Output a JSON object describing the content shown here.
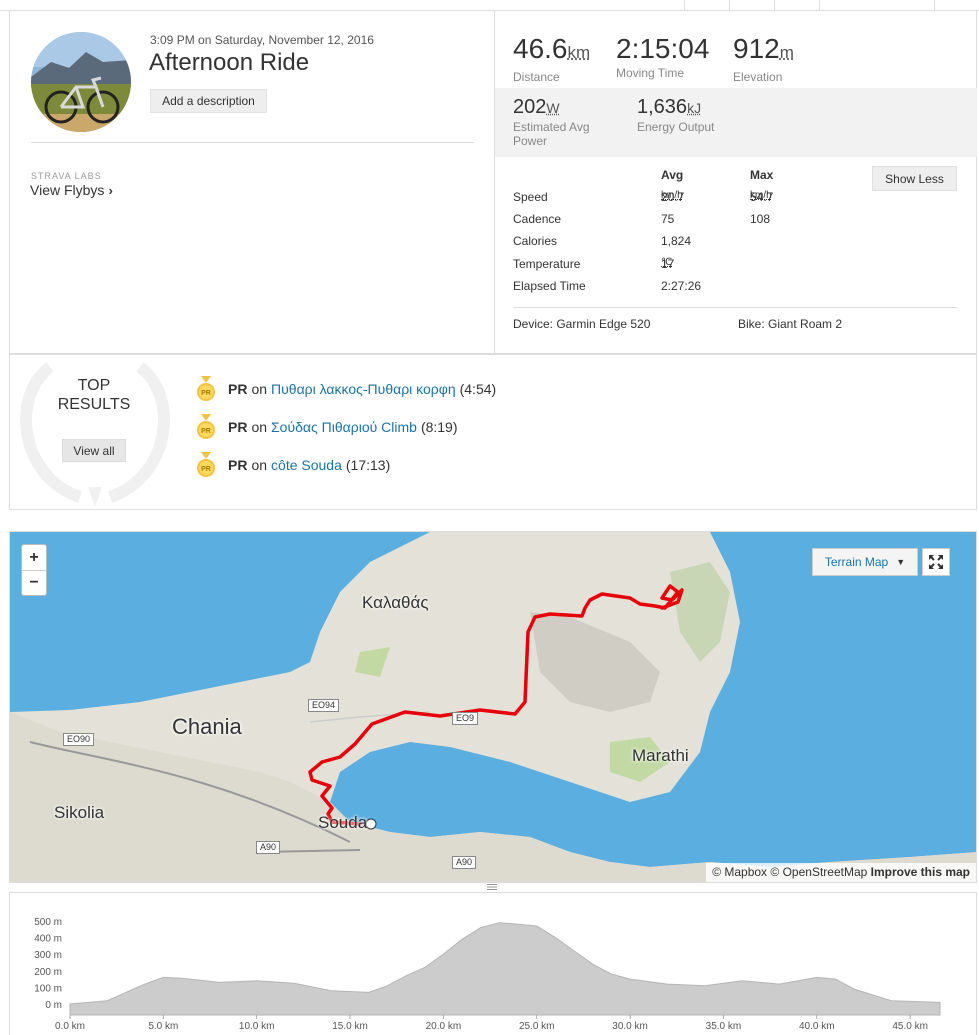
{
  "activity": {
    "timestamp": "3:09 PM on Saturday, November 12, 2016",
    "title": "Afternoon Ride",
    "add_description": "Add a description",
    "labs_label": "STRAVA LABS",
    "flybys_label": "View Flybys"
  },
  "stats": {
    "distance": {
      "value": "46.6",
      "unit": "km",
      "label": "Distance"
    },
    "moving_time": {
      "value": "2:15:04",
      "label": "Moving Time"
    },
    "elevation": {
      "value": "912",
      "unit": "m",
      "label": "Elevation"
    },
    "power": {
      "value": "202",
      "unit": "W",
      "label": "Estimated Avg Power"
    },
    "energy": {
      "value": "1,636",
      "unit": "kJ",
      "label": "Energy Output"
    }
  },
  "more_stats": {
    "avg_header": "Avg",
    "max_header": "Max",
    "show_less": "Show Less",
    "rows": [
      {
        "label": "Speed",
        "avg": "20.7",
        "avg_unit": "km/h",
        "max": "54.7",
        "max_unit": "km/h"
      },
      {
        "label": "Cadence",
        "avg": "75",
        "avg_unit": "",
        "max": "108",
        "max_unit": ""
      },
      {
        "label": "Calories",
        "avg": "1,824",
        "avg_unit": "",
        "max": "",
        "max_unit": ""
      },
      {
        "label": "Temperature",
        "avg": "17",
        "avg_unit": "℃",
        "max": "",
        "max_unit": ""
      },
      {
        "label": "Elapsed Time",
        "avg": "2:27:26",
        "avg_unit": "",
        "max": "",
        "max_unit": ""
      }
    ],
    "device": "Device: Garmin Edge 520",
    "bike": "Bike: Giant Roam 2"
  },
  "top_results": {
    "title_line1": "TOP",
    "title_line2": "RESULTS",
    "view_all": "View all",
    "items": [
      {
        "badge": "PR",
        "prefix": "PR",
        "on": "on",
        "segment": "Πυθαρι λακκος-Πυθαρι κορφη",
        "time": "(4:54)"
      },
      {
        "badge": "PR",
        "prefix": "PR",
        "on": "on",
        "segment": "Σούδας Πιθαριού Climb",
        "time": "(8:19)"
      },
      {
        "badge": "PR",
        "prefix": "PR",
        "on": "on",
        "segment": "côte Souda",
        "time": "(17:13)"
      }
    ]
  },
  "map": {
    "zoom_in": "+",
    "zoom_out": "−",
    "map_type": "Terrain Map",
    "labels": {
      "kalathas": "Καλαθάς",
      "chania": "Chania",
      "sikolia": "Sikolia",
      "souda": "Souda",
      "marathi": "Marathi"
    },
    "roads": {
      "eo94": "EO94",
      "eo90": "EO90",
      "a90a": "A90",
      "a90b": "A90",
      "eo": "EO9"
    },
    "attribution_mapbox": "© Mapbox",
    "attribution_osm": "© OpenStreetMap",
    "improve": "Improve this map",
    "route_color": "#e8000b"
  },
  "elevation_chart": {
    "y_ticks": [
      "500 m",
      "400 m",
      "300 m",
      "200 m",
      "100 m",
      "0 m"
    ],
    "x_ticks": [
      "0.0 km",
      "5.0 km",
      "10.0 km",
      "15.0 km",
      "20.0 km",
      "25.0 km",
      "30.0 km",
      "35.0 km",
      "40.0 km",
      "45.0 km"
    ]
  },
  "chart_data": {
    "type": "area",
    "xlabel": "",
    "ylabel": "",
    "xlim": [
      0,
      46.6
    ],
    "ylim": [
      -50,
      500
    ],
    "x": [
      0,
      2,
      4,
      5,
      6,
      8,
      10,
      12,
      14,
      16,
      17,
      18,
      19,
      20,
      21,
      22,
      23,
      24,
      25,
      26,
      27,
      28,
      29,
      30,
      32,
      34,
      36,
      38,
      40,
      41,
      42,
      44,
      46.6
    ],
    "series": [
      {
        "values": [
          0,
          20,
          120,
          160,
          155,
          130,
          140,
          125,
          80,
          70,
          110,
          170,
          220,
          300,
          390,
          460,
          490,
          480,
          470,
          400,
          320,
          240,
          180,
          150,
          120,
          110,
          140,
          120,
          160,
          150,
          90,
          20,
          10
        ]
      }
    ],
    "fill_color": "#cccccc"
  }
}
